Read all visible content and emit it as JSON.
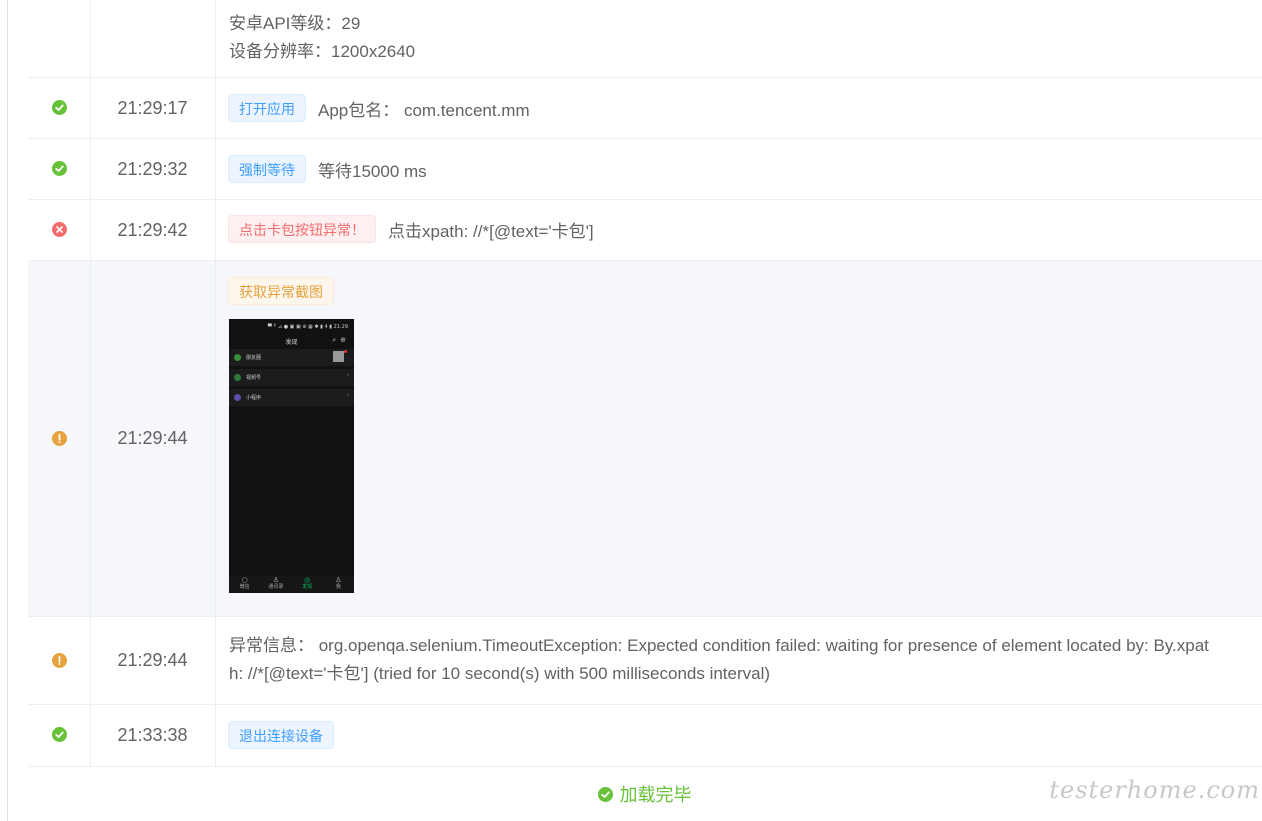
{
  "rows": [
    {
      "time": "",
      "lines": [
        "安卓API等级：29",
        "设备分辨率：1200x2640"
      ]
    },
    {
      "status": "success",
      "time": "21:29:17",
      "tag": "打开应用",
      "text": "App包名：  com.tencent.mm"
    },
    {
      "status": "success",
      "time": "21:29:32",
      "tag": "强制等待",
      "text": "等待15000 ms"
    },
    {
      "status": "error",
      "time": "21:29:42",
      "tag": "点击卡包按钮异常！",
      "text": "点击xpath: //*[@text='卡包']"
    },
    {
      "status": "warning",
      "time": "21:29:44",
      "tag": "获取异常截图",
      "screenshot": {
        "status_bar": "▀ ╹ ⊿ ● ▣ ▣  ⊕ ▦ ✱ ▮ 4 ▮ 21:29",
        "title": "发现",
        "items": [
          "朋友圈",
          "视频号",
          "小程序"
        ],
        "tabs": [
          "微信",
          "通讯录",
          "发现",
          "我"
        ]
      }
    },
    {
      "status": "warning",
      "time": "21:29:44",
      "lines": [
        "异常信息：  org.openqa.selenium.TimeoutException: Expected condition failed: waiting for presence of element located by: By.xpat",
        "h: //*[@text='卡包'] (tried for 10 second(s) with 500 milliseconds interval)"
      ]
    },
    {
      "status": "success",
      "time": "21:33:38",
      "tag": "退出连接设备"
    }
  ],
  "footer": {
    "text": "加载完毕"
  },
  "watermark": "testerhome.com",
  "colors": {
    "success": "#67c23a",
    "error": "#f56c6c",
    "warning": "#e6a23c",
    "primary": "#409eff"
  }
}
